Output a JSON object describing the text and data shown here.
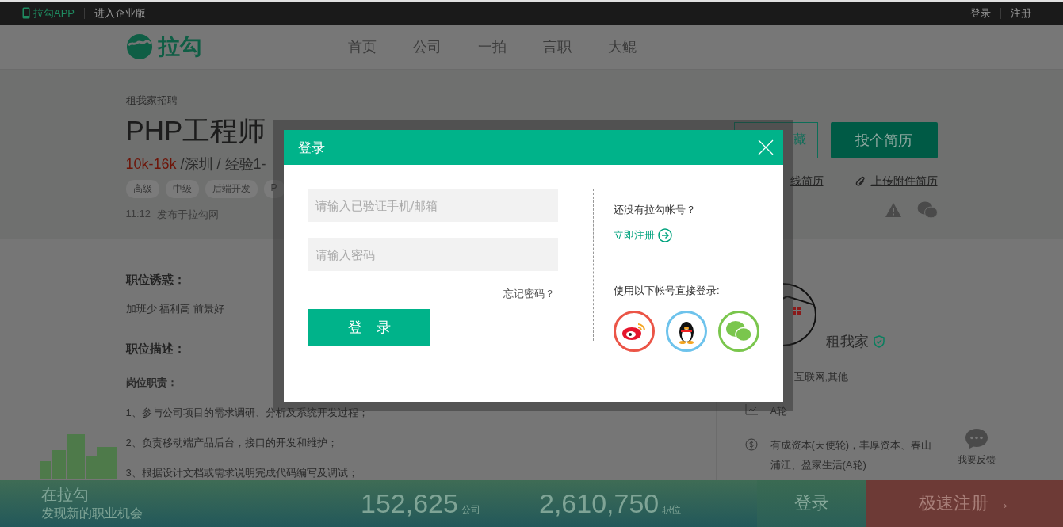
{
  "top_bar": {
    "app_link": "拉勾APP",
    "enterprise_link": "进入企业版",
    "login_link": "登录",
    "register_link": "注册"
  },
  "nav": {
    "logo_text": "拉勾",
    "items": [
      "首页",
      "公司",
      "一拍",
      "言职",
      "大鲲"
    ]
  },
  "job": {
    "company_line": "租我家招聘",
    "title": "PHP工程师",
    "salary": "10k-16k",
    "meta": " /深圳 / 经验1-",
    "tags": [
      "高级",
      "中级",
      "后端开发",
      "P"
    ],
    "posted_time": "11:12",
    "posted_source": "发布于拉勾网",
    "collect_button": "藏",
    "apply_button": "投个简历",
    "online_resume_link": "线简历",
    "upload_resume_link": "上传附件简历"
  },
  "details": {
    "perks_heading": "职位诱惑：",
    "perks": "加班少 福利高 前景好",
    "description_heading": "职位描述：",
    "duties_heading": "岗位职责：",
    "duties": [
      "1、参与公司项目的需求调研、分析及系统开发过程；",
      "2、负责移动端产品后台，接口的开发和维护；",
      "3、根据设计文档或需求说明完成代码编写及调试；"
    ]
  },
  "company": {
    "name": "租我家",
    "verified": true,
    "info": [
      {
        "kind": "industry",
        "text": "互联网,其他"
      },
      {
        "kind": "stage",
        "text": "A轮"
      },
      {
        "kind": "investors",
        "text": "有成资本(天使轮)，丰厚资本、春山浦江、盈家生活(A轮)"
      }
    ]
  },
  "feedback": "我要反馈",
  "bottom_bar": {
    "slogan": "在拉勾",
    "subtitle": "发现新的职业机会",
    "companies_count": "152,625",
    "companies_label": "公司",
    "jobs_count": "2,610,750",
    "jobs_label": "职位",
    "login_button": "登录",
    "register_button": "极速注册",
    "register_arrow": "→"
  },
  "login_dialog": {
    "title": "登录",
    "account_placeholder": "请输入已验证手机/邮箱",
    "password_placeholder": "请输入密码",
    "forgot_link": "忘记密码？",
    "login_button": "登　录",
    "no_account_text": "还没有拉勾帐号？",
    "register_link": "立即注册",
    "social_text": "使用以下帐号直接登录:",
    "social": [
      {
        "kind": "weibo",
        "color": "#eb5547"
      },
      {
        "kind": "qq",
        "color": "#6ec3ec"
      },
      {
        "kind": "wechat",
        "color": "#7ac64d"
      }
    ]
  }
}
